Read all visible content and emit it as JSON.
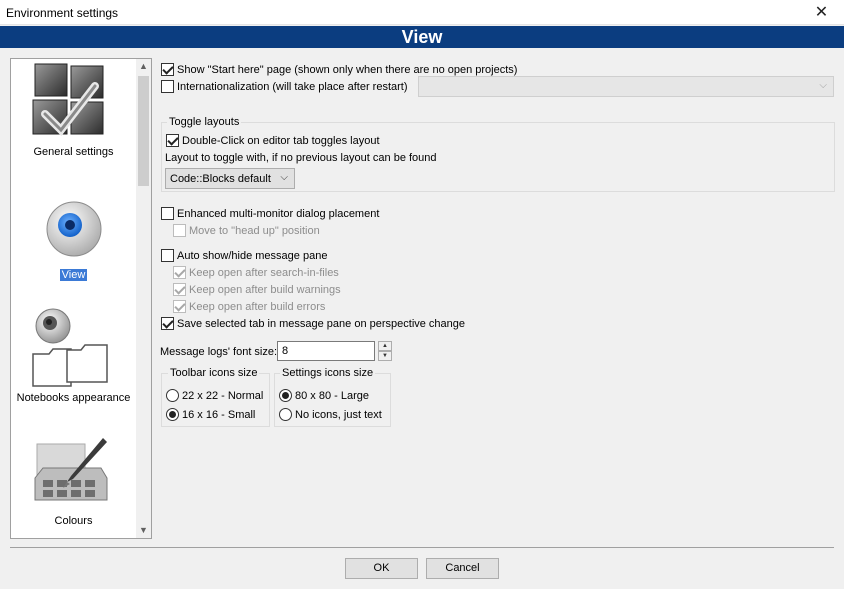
{
  "window": {
    "title": "Environment settings",
    "close_glyph": "✕"
  },
  "banner": {
    "title": "View"
  },
  "sidebar": {
    "items": [
      {
        "label": "General settings",
        "icon": "general-settings-icon",
        "selected": false
      },
      {
        "label": "View",
        "icon": "view-eye-icon",
        "selected": true
      },
      {
        "label": "Notebooks appearance",
        "icon": "notebooks-icon",
        "selected": false
      },
      {
        "label": "Colours",
        "icon": "colours-palette-icon",
        "selected": false
      }
    ]
  },
  "options": {
    "show_start_here": {
      "label": "Show \"Start here\" page (shown only when there are no open projects)",
      "checked": true
    },
    "internationalization": {
      "label": "Internationalization (will take place after restart)",
      "checked": false,
      "combo_value": ""
    },
    "toggle_layouts": {
      "title": "Toggle layouts",
      "double_click": {
        "label": "Double-Click on editor tab toggles layout",
        "checked": true
      },
      "layout_prompt": "Layout to toggle with, if no previous layout can be found",
      "layout_value": "Code::Blocks default"
    },
    "multi_monitor": {
      "label": "Enhanced multi-monitor dialog placement",
      "checked": false
    },
    "head_up": {
      "label": "Move to \"head up\" position",
      "checked": false
    },
    "auto_show": {
      "label": "Auto show/hide message pane",
      "checked": false
    },
    "keep_search": {
      "label": "Keep open after search-in-files",
      "checked": true
    },
    "keep_warnings": {
      "label": "Keep open after build warnings",
      "checked": true
    },
    "keep_errors": {
      "label": "Keep open after build errors",
      "checked": true
    },
    "save_tab": {
      "label": "Save selected tab in message pane on perspective change",
      "checked": true
    },
    "font_size": {
      "label": "Message logs' font size:",
      "value": "8"
    },
    "toolbar_icons": {
      "title": "Toolbar icons size",
      "opt1": "22 x 22 - Normal",
      "opt2": "16 x 16 - Small",
      "selected": "16 x 16 - Small"
    },
    "settings_icons": {
      "title": "Settings icons size",
      "opt1": "80 x 80 - Large",
      "opt2": "No icons, just text",
      "selected": "80 x 80 - Large"
    }
  },
  "buttons": {
    "ok": "OK",
    "cancel": "Cancel"
  }
}
